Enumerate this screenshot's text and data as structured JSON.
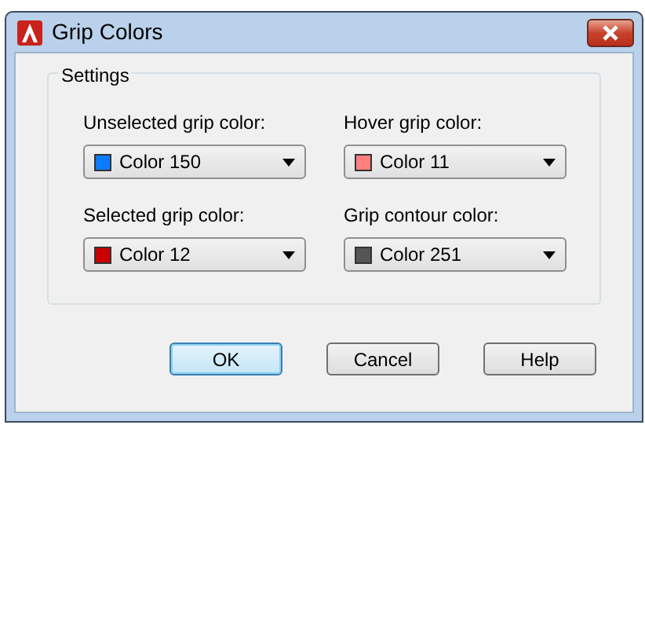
{
  "window": {
    "title": "Grip Colors"
  },
  "settings": {
    "legend": "Settings",
    "fields": [
      {
        "label": "Unselected grip color:",
        "value": "Color 150",
        "color": "#0a7cff"
      },
      {
        "label": "Hover grip color:",
        "value": "Color 11",
        "color": "#ff7f7f"
      },
      {
        "label": "Selected grip color:",
        "value": "Color 12",
        "color": "#cc0000"
      },
      {
        "label": "Grip contour color:",
        "value": "Color 251",
        "color": "#555555"
      }
    ]
  },
  "buttons": [
    {
      "label": "OK",
      "default": true
    },
    {
      "label": "Cancel",
      "default": false
    },
    {
      "label": "Help",
      "default": false
    }
  ]
}
